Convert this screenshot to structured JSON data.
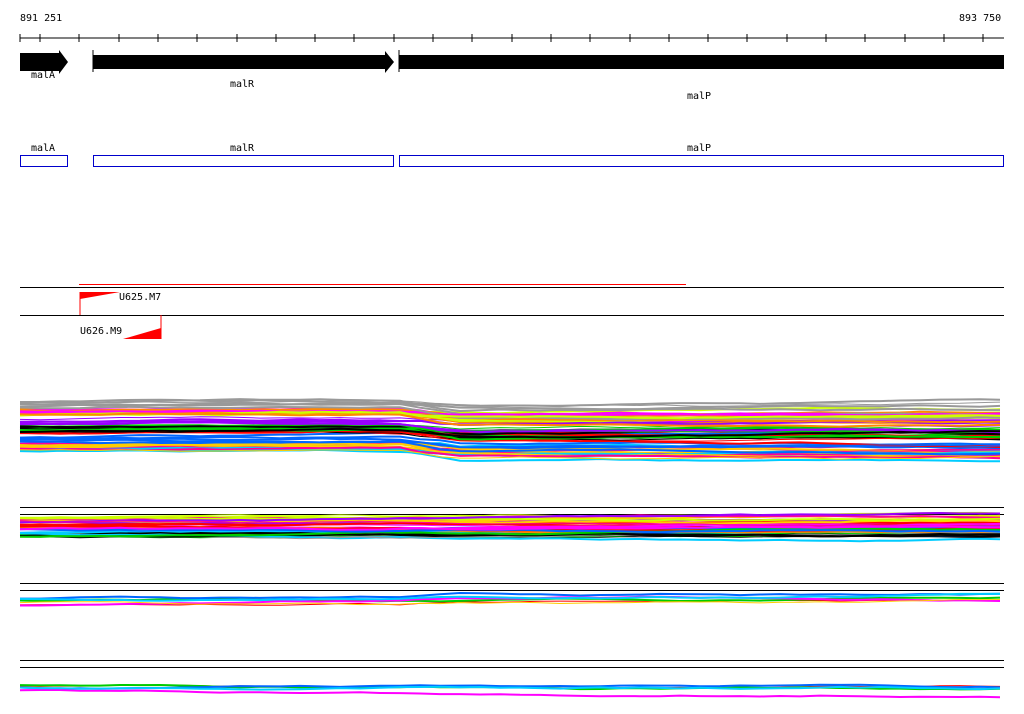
{
  "ruler": {
    "start": "891 251",
    "end": "893 750"
  },
  "genes": [
    {
      "name": "malA",
      "strand": "+"
    },
    {
      "name": "malR",
      "strand": "+"
    },
    {
      "name": "malP",
      "strand": "+"
    }
  ],
  "boxes": [
    {
      "name": "malA"
    },
    {
      "name": "malR"
    },
    {
      "name": "malP"
    }
  ],
  "markers": [
    {
      "name": "U625.M7"
    },
    {
      "name": "U626.M9"
    }
  ],
  "colors": {
    "gene": "#000000",
    "box": "#0000cc",
    "marker": "#ff0000",
    "palette": [
      "#ff0000",
      "#00cc00",
      "#0066ff",
      "#ff00ff",
      "#00ccff",
      "#ffcc00",
      "#999999",
      "#000000",
      "#ccff00",
      "#ff8800",
      "#9900ff",
      "#ff0099"
    ]
  }
}
